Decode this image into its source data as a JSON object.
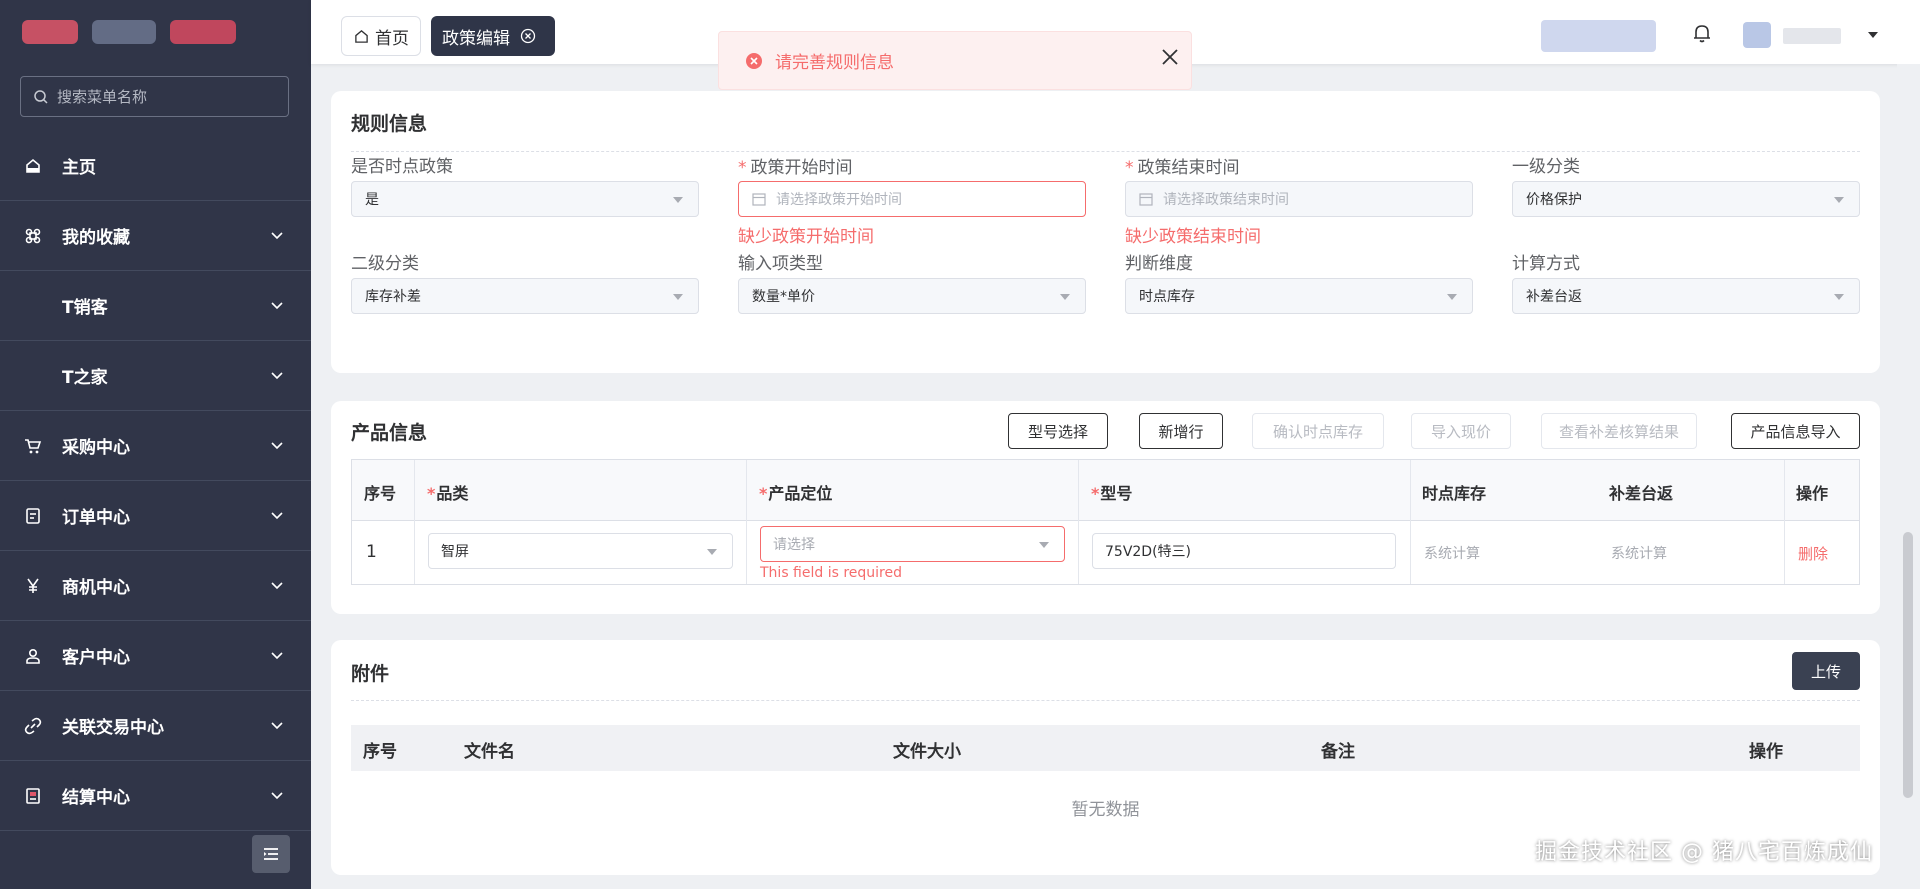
{
  "sidebar": {
    "search_placeholder": "搜索菜单名称",
    "items": [
      {
        "label": "主页",
        "icon": "home-icon",
        "expandable": false,
        "sub": false
      },
      {
        "label": "我的收藏",
        "icon": "command-icon",
        "expandable": true,
        "sub": false
      },
      {
        "label": "T销客",
        "icon": "",
        "expandable": true,
        "sub": true
      },
      {
        "label": "T之家",
        "icon": "",
        "expandable": true,
        "sub": true
      },
      {
        "label": "采购中心",
        "icon": "cart-icon",
        "expandable": true,
        "sub": false
      },
      {
        "label": "订单中心",
        "icon": "document-icon",
        "expandable": true,
        "sub": false
      },
      {
        "label": "商机中心",
        "icon": "yen-icon",
        "expandable": true,
        "sub": false
      },
      {
        "label": "客户中心",
        "icon": "user-icon",
        "expandable": true,
        "sub": false
      },
      {
        "label": "关联交易中心",
        "icon": "link-icon",
        "expandable": true,
        "sub": false
      },
      {
        "label": "结算中心",
        "icon": "invoice-icon",
        "expandable": true,
        "sub": false
      }
    ]
  },
  "tabs": {
    "home": "首页",
    "active": "政策编辑"
  },
  "toast": {
    "message": "请完善规则信息"
  },
  "rules": {
    "title": "规则信息",
    "fields": {
      "is_point_policy": {
        "label": "是否时点政策",
        "value": "是"
      },
      "start_time": {
        "label": "政策开始时间",
        "placeholder": "请选择政策开始时间",
        "error": "缺少政策开始时间"
      },
      "end_time": {
        "label": "政策结束时间",
        "placeholder": "请选择政策结束时间",
        "error": "缺少政策结束时间"
      },
      "level1": {
        "label": "一级分类",
        "value": "价格保护"
      },
      "level2": {
        "label": "二级分类",
        "value": "库存补差"
      },
      "input_type": {
        "label": "输入项类型",
        "value": "数量*单价"
      },
      "dimension": {
        "label": "判断维度",
        "value": "时点库存"
      },
      "calc_method": {
        "label": "计算方式",
        "value": "补差台返"
      }
    }
  },
  "products": {
    "title": "产品信息",
    "buttons": {
      "model_select": "型号选择",
      "add_row": "新增行",
      "confirm_stock": "确认时点库存",
      "import_price": "导入现价",
      "view_result": "查看补差核算结果",
      "import_info": "产品信息导入"
    },
    "columns": {
      "index": "序号",
      "category": "品类",
      "positioning": "产品定位",
      "model": "型号",
      "stock": "时点库存",
      "rebate": "补差台返",
      "action": "操作"
    },
    "rows": [
      {
        "index": "1",
        "category": "智屏",
        "positioning_placeholder": "请选择",
        "positioning_error": "This field is required",
        "model": "75V2D(特三)",
        "stock": "系统计算",
        "rebate": "系统计算",
        "action": "删除"
      }
    ]
  },
  "attachments": {
    "title": "附件",
    "upload": "上传",
    "columns": {
      "index": "序号",
      "filename": "文件名",
      "size": "文件大小",
      "note": "备注",
      "action": "操作"
    },
    "empty": "暂无数据"
  },
  "footer_watermark": "掘金技术社区 @ 猪八宅百炼成仙",
  "colors": {
    "sidebar_bg": "#303548",
    "error": "#f56c6c",
    "active_tab": "#2f3548",
    "page_bg": "#eef0f3"
  }
}
